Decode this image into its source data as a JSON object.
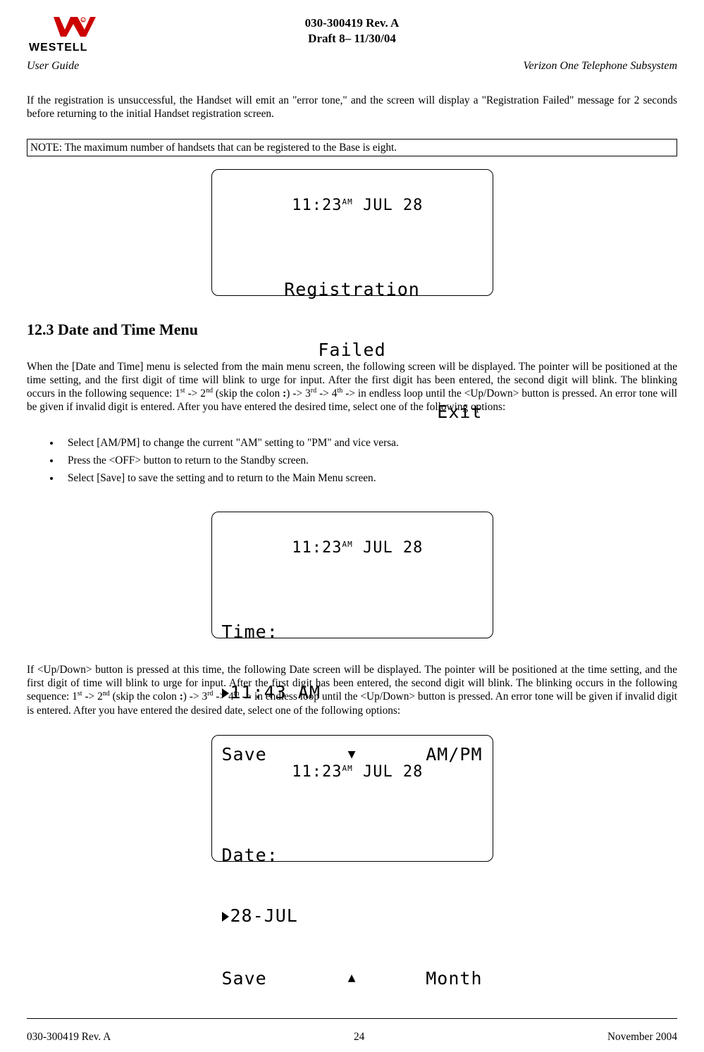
{
  "header": {
    "doc_id": "030-300419 Rev. A",
    "draft_line": "Draft 8– 11/30/04",
    "left": "User Guide",
    "right": "Verizon One Telephone Subsystem"
  },
  "para1": "If the registration is unsuccessful, the Handset will emit an \"error tone,\" and the screen will display a \"Registration Failed\" message for 2 seconds before returning to the initial Handset registration screen.",
  "note": "NOTE: The maximum number of handsets that can be registered to the Base is eight.",
  "lcd1": {
    "time": "11:23",
    "ampm": "AM",
    "date": "JUL 28",
    "line1": "Registration",
    "line2": "Failed",
    "right": "Exit"
  },
  "section_title": "12.3 Date and Time Menu",
  "para2a": "When the [Date and Time] menu is selected from the main menu screen, the following screen will be displayed. The pointer will be positioned at the time setting, and the first digit of time will blink to urge for input.  After the first digit has been entered, the second digit will blink.  The blinking occurs in the following sequence: 1",
  "para2b": " -> 2",
  "para2c": " (skip the colon ",
  "para2d": ")  -> 3",
  "para2e": "  -> 4",
  "para2f": " -> in endless loop until the <Up/Down> button is pressed. An error tone will be given if invalid digit is entered. After you have entered the desired time, select one of the following options:",
  "bullets": {
    "b1": "Select [AM/PM] to change the current \"AM\" setting to \"PM\" and vice versa.",
    "b2": "Press the <OFF> button to return to the Standby screen.",
    "b3": "Select [Save] to save the setting and to return to the Main Menu screen."
  },
  "lcd2": {
    "time": "11:23",
    "ampm": "AM",
    "date": "JUL 28",
    "line1": "Time:",
    "line2": "11:43 AM",
    "left": "Save",
    "mid": "▼",
    "right": "AM/PM"
  },
  "para3a": "If <Up/Down> button is pressed at this time, the following Date screen will be displayed. The pointer will be positioned at the time setting, and the first digit of time will blink to urge for input.  After the first digit has been entered, the second digit will blink.  The blinking occurs in the following sequence: 1",
  "para3b": " -> 2",
  "para3c": " (skip the colon ",
  "para3d": ")  -> 3",
  "para3e": "  -> 4",
  "para3f": " -> in endless loop until the <Up/Down> button is pressed. An error tone will be given if invalid digit is entered. After you have entered the desired date, select one of the following options:",
  "lcd3": {
    "time": "11:23",
    "ampm": "AM",
    "date": "JUL 28",
    "line1": "Date:",
    "line2": "28-JUL",
    "left": "Save",
    "mid": "▲",
    "right": "Month"
  },
  "ord": {
    "st": "st",
    "nd": "nd",
    "rd": "rd",
    "th": "th"
  },
  "colon_glyph": ":",
  "footer": {
    "left": "030-300419 Rev. A",
    "center": "24",
    "right": "November 2004"
  }
}
